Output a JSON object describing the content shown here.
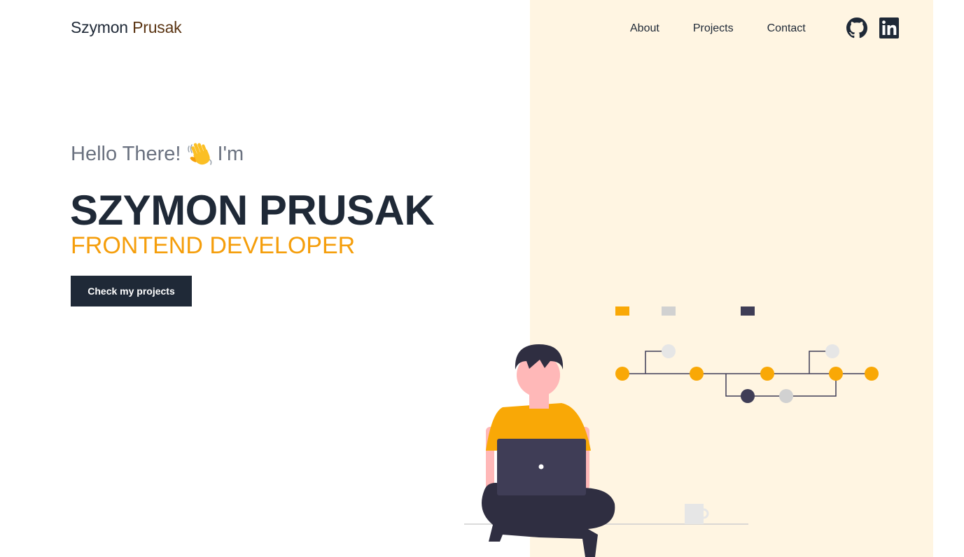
{
  "header": {
    "logo_first": "Szymon",
    "logo_last": "Prusak",
    "nav": [
      "About",
      "Projects",
      "Contact"
    ],
    "social_icons": [
      "github-icon",
      "linkedin-icon"
    ]
  },
  "hero": {
    "greeting": "Hello There!",
    "greeting_suffix": "I'm",
    "wave_icon": "waving-hand-icon",
    "name": "SZYMON PRUSAK",
    "role": "FRONTEND DEVELOPER",
    "cta_label": "Check my projects"
  },
  "colors": {
    "accent": "#f59e0b",
    "dark": "#1f2937",
    "panel": "#fff5e2",
    "muted": "#6b7280"
  }
}
